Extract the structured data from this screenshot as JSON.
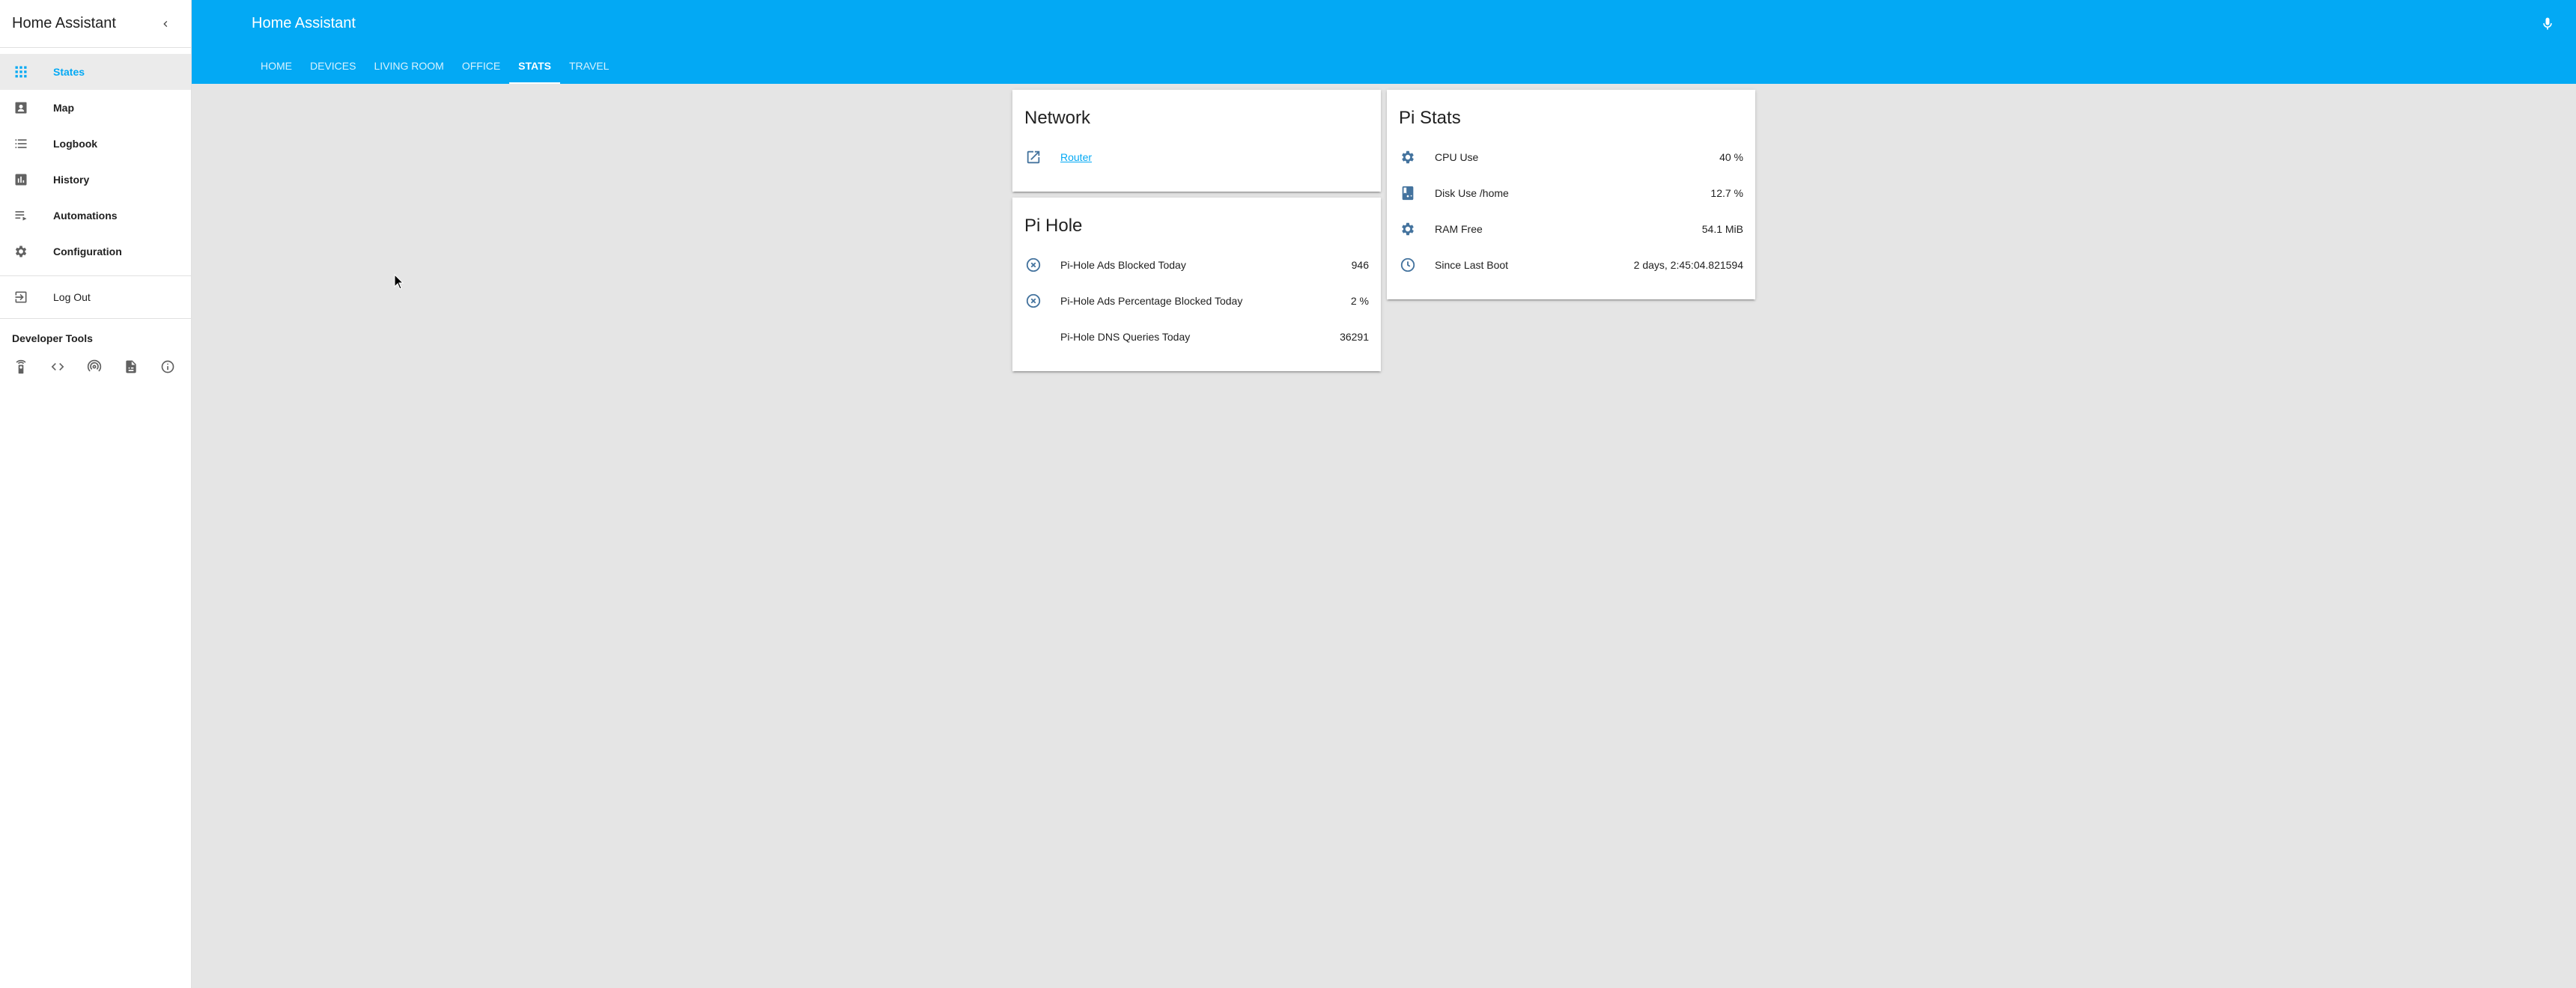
{
  "app": {
    "title": "Home Assistant"
  },
  "colors": {
    "primary": "#03a9f4",
    "icon": "#44739e",
    "background": "#e5e5e5"
  },
  "sidebar": {
    "title": "Home Assistant",
    "items": [
      {
        "label": "States",
        "icon": "grid-icon",
        "active": true
      },
      {
        "label": "Map",
        "icon": "map-icon"
      },
      {
        "label": "Logbook",
        "icon": "logbook-icon"
      },
      {
        "label": "History",
        "icon": "history-icon"
      },
      {
        "label": "Automations",
        "icon": "automations-icon"
      },
      {
        "label": "Configuration",
        "icon": "gear-icon"
      }
    ],
    "logout_label": "Log Out",
    "developer_tools_label": "Developer Tools",
    "developer_tools_icons": [
      "remote-icon",
      "code-icon",
      "broadcast-icon",
      "template-icon",
      "info-icon"
    ]
  },
  "toolbar": {
    "title": "Home Assistant",
    "tabs": [
      "HOME",
      "DEVICES",
      "LIVING ROOM",
      "OFFICE",
      "STATS",
      "TRAVEL"
    ],
    "active_tab": "STATS"
  },
  "cards": {
    "network": {
      "title": "Network",
      "rows": [
        {
          "name": "Router",
          "icon": "open-in-new-icon"
        }
      ]
    },
    "pihole": {
      "title": "Pi Hole",
      "rows": [
        {
          "name": "Pi-Hole Ads Blocked Today",
          "state": "946",
          "icon": "close-circle-icon"
        },
        {
          "name": "Pi-Hole Ads Percentage Blocked Today",
          "state": "2 %",
          "icon": "close-circle-icon"
        },
        {
          "name": "Pi-Hole DNS Queries Today",
          "state": "36291"
        }
      ]
    },
    "pistats": {
      "title": "Pi Stats",
      "rows": [
        {
          "name": "CPU Use",
          "state": "40 %",
          "icon": "cpu-icon"
        },
        {
          "name": "Disk Use /home",
          "state": "12.7 %",
          "icon": "harddisk-icon"
        },
        {
          "name": "RAM Free",
          "state": "54.1 MiB",
          "icon": "memory-icon"
        },
        {
          "name": "Since Last Boot",
          "state": "2 days, 2:45:04.821594",
          "icon": "clock-icon"
        }
      ]
    }
  }
}
